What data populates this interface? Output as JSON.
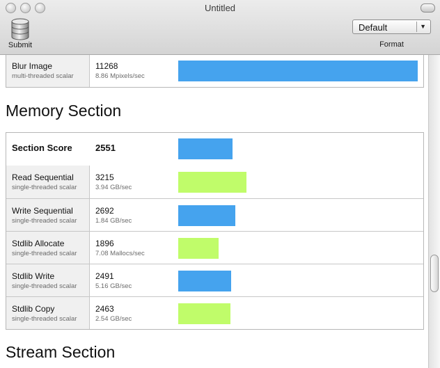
{
  "window": {
    "title": "Untitled"
  },
  "toolbar": {
    "submit_label": "Submit",
    "format_label": "Format",
    "format_value": "Default"
  },
  "colors": {
    "blue": "#45a3ee",
    "green": "#c0fc6a"
  },
  "bar_scale_max": 11268,
  "top_row": {
    "name": "Blur Image",
    "subtitle": "multi-threaded scalar",
    "score": "11268",
    "rate": "8.86 Mpixels/sec",
    "color": "blue"
  },
  "memory_section": {
    "title": "Memory Section",
    "score_label": "Section Score",
    "score": "2551",
    "rows": [
      {
        "name": "Read Sequential",
        "subtitle": "single-threaded scalar",
        "score": "3215",
        "rate": "3.94 GB/sec",
        "color": "green"
      },
      {
        "name": "Write Sequential",
        "subtitle": "single-threaded scalar",
        "score": "2692",
        "rate": "1.84 GB/sec",
        "color": "blue"
      },
      {
        "name": "Stdlib Allocate",
        "subtitle": "single-threaded scalar",
        "score": "1896",
        "rate": "7.08 Mallocs/sec",
        "color": "green"
      },
      {
        "name": "Stdlib Write",
        "subtitle": "single-threaded scalar",
        "score": "2491",
        "rate": "5.16 GB/sec",
        "color": "blue"
      },
      {
        "name": "Stdlib Copy",
        "subtitle": "single-threaded scalar",
        "score": "2463",
        "rate": "2.54 GB/sec",
        "color": "green"
      }
    ]
  },
  "stream_section": {
    "title": "Stream Section"
  }
}
